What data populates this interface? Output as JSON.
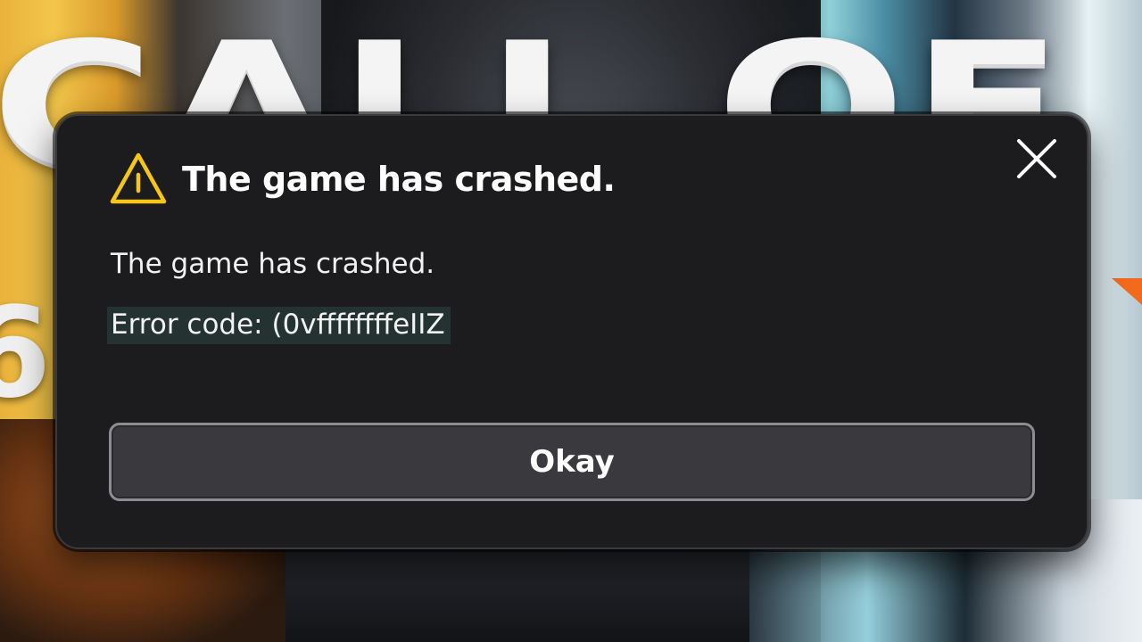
{
  "background": {
    "title_art": "CALL OF DUTY",
    "subtitle_art": "6"
  },
  "dialog": {
    "title": "The game has crashed.",
    "message": "The game has crashed.",
    "error_code": "Error code: (0vffffffffeIIZ",
    "okay_label": "Okay",
    "icons": {
      "warning": "warning-triangle-icon",
      "close": "close-icon"
    },
    "colors": {
      "warning": "#f5c518",
      "panel": "#1c1c1e",
      "button": "#3a3a3e",
      "error_highlight": "#243231"
    }
  }
}
